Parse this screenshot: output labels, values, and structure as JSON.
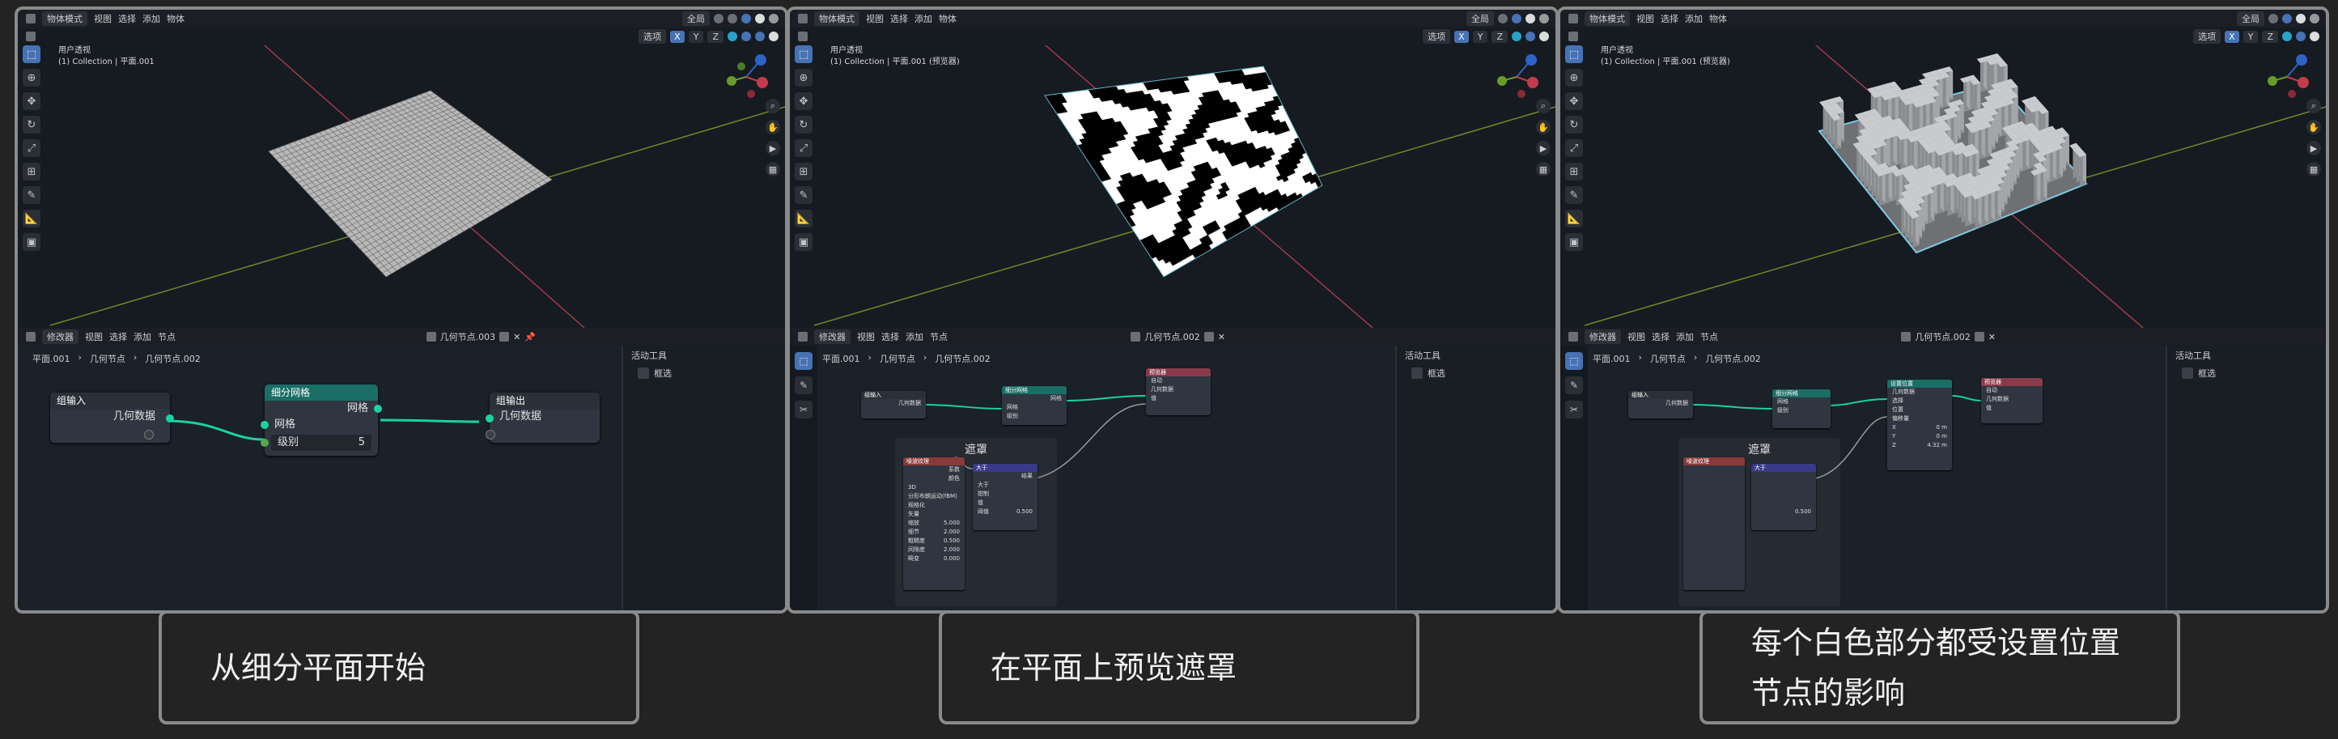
{
  "colors": {
    "accent": "#4772b3",
    "wire": "#1cd1a1",
    "geoHeader": "#1a6e66",
    "vecHeader": "#3a3a8a",
    "attrHeader": "#8a3a3a"
  },
  "header": {
    "mode": "物体模式",
    "menus": [
      "视图",
      "选择",
      "添加",
      "物体"
    ],
    "global": "全局",
    "options": "选项",
    "xyz": [
      "X",
      "Y",
      "Z"
    ]
  },
  "viewport": {
    "view_name": "用户透视",
    "collections": [
      "(1) Collection | 平面.001",
      "(1) Collection | 平面.001 (预览器)",
      "(1) Collection | 平面.001 (预览器)"
    ]
  },
  "editor": {
    "type": "修改器",
    "menus": [
      "视图",
      "选择",
      "添加",
      "节点"
    ],
    "tree_names": [
      "几何节点.003",
      "几何节点.002",
      "几何节点.002"
    ],
    "breadcrumb": [
      "平面.001",
      "几何节点",
      "几何节点.002"
    ],
    "sidebar_title": "活动工具",
    "sidebar_item": "框选"
  },
  "panel1_nodes": {
    "group_input": {
      "title": "组输入",
      "socket": "几何数据"
    },
    "subdivide": {
      "title": "细分网格",
      "out": "网格",
      "in": "网格",
      "level_label": "级别",
      "level_value": "5"
    },
    "group_output": {
      "title": "组输出",
      "socket": "几何数据"
    }
  },
  "panel2_nodes": {
    "frame_label": "遮罩",
    "group_input": "组输入",
    "group_input_socket": "几何数据",
    "subdivide": "细分网格",
    "subdivide_rows": [
      "网格",
      "级别"
    ],
    "subdivide_out": "网格",
    "viewer": "预览器",
    "viewer_rows": [
      "自动",
      "几何数据",
      "值"
    ],
    "noise": "噪波纹理",
    "noise_out": [
      "系数",
      "颜色"
    ],
    "noise_rows": [
      "3D",
      "分形布朗运动(fBM)",
      "规格化",
      "矢量",
      "缩放",
      "细节",
      "粗糙度",
      "间隙度",
      "畸变"
    ],
    "noise_values": [
      "5.000",
      "2.000",
      "0.500",
      "2.000",
      "0.000"
    ],
    "compare": "大于",
    "compare_rows": [
      "结果",
      "大于",
      "钳制",
      "值",
      "阈值"
    ],
    "compare_threshold": "0.500"
  },
  "panel3_nodes": {
    "frame_label": "遮罩",
    "group_input": "组输入",
    "group_input_socket": "几何数据",
    "subdivide": "细分网格",
    "subdivide_rows": [
      "网格",
      "级别"
    ],
    "set_position": "设置位置",
    "set_position_rows": [
      "几何数据",
      "选择",
      "位置",
      "偏移量",
      "X",
      "Y",
      "Z"
    ],
    "set_position_values": [
      "0 m",
      "0 m",
      "4.32 m"
    ],
    "viewer": "预览器",
    "viewer_rows": [
      "自动",
      "几何数据",
      "值"
    ],
    "noise": "噪波纹理",
    "compare": "大于",
    "compare_threshold": "0.500"
  },
  "captions": [
    "从细分平面开始",
    "在平面上预览遮罩",
    "每个白色部分都受设置位置节点的影响"
  ]
}
